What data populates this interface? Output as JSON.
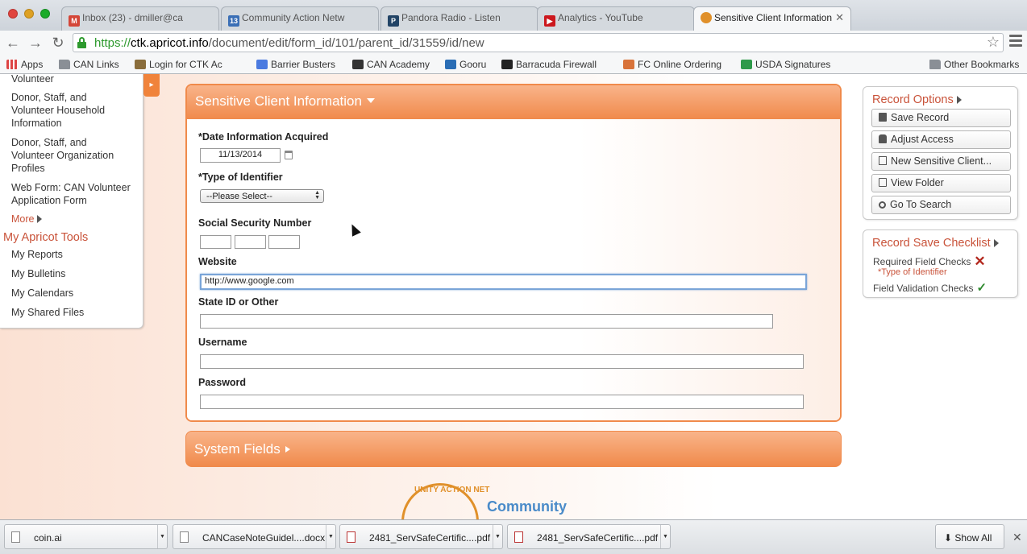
{
  "browser": {
    "tabs": [
      {
        "title": "Inbox (23) - dmiller@ca",
        "icon": "gmail-icon",
        "icon_color": "#d44638"
      },
      {
        "title": "Community Action Netw",
        "icon": "calendar-icon",
        "icon_color": "#3b6fb6"
      },
      {
        "title": "Pandora Radio - Listen",
        "icon": "pandora-icon",
        "icon_color": "#224466"
      },
      {
        "title": "Analytics - YouTube",
        "icon": "youtube-icon",
        "icon_color": "#cc181e"
      },
      {
        "title": "Sensitive Client Information",
        "icon": "apricot-icon",
        "icon_color": "#e0902a"
      }
    ],
    "url": {
      "scheme": "https://",
      "host": "ctk.apricot.info",
      "path": "/document/edit/form_id/101/parent_id/31559/id/new"
    },
    "bookmarks": [
      {
        "label": "Apps",
        "icon": "apps-icon"
      },
      {
        "label": "CAN Links",
        "icon": "folder-icon"
      },
      {
        "label": "Login for CTK Ac",
        "icon": "bookmark-icon"
      },
      {
        "label": "Barrier Busters",
        "icon": "google-icon"
      },
      {
        "label": "CAN Academy",
        "icon": "bookmark-icon"
      },
      {
        "label": "Gooru",
        "icon": "bookmark-icon"
      },
      {
        "label": "Barracuda Firewall",
        "icon": "bookmark-icon"
      },
      {
        "label": "FC Online Ordering",
        "icon": "bookmark-icon"
      },
      {
        "label": "USDA Signatures",
        "icon": "sheets-icon"
      },
      {
        "label": "Other Bookmarks",
        "icon": "folder-icon"
      }
    ]
  },
  "sidebar": {
    "items": [
      {
        "label": "Volunteer"
      },
      {
        "label": "Donor, Staff, and Volunteer Household Information"
      },
      {
        "label": "Donor, Staff, and Volunteer Organization Profiles"
      },
      {
        "label": "Web Form: CAN Volunteer Application Form"
      }
    ],
    "more_label": "More",
    "tools_title": "My Apricot Tools",
    "tools": [
      {
        "label": "My Reports"
      },
      {
        "label": "My Bulletins"
      },
      {
        "label": "My Calendars"
      },
      {
        "label": "My Shared Files"
      }
    ]
  },
  "form": {
    "section_title": "Sensitive Client Information",
    "date_label": "*Date Information Acquired",
    "date_value": "11/13/2014",
    "identifier_label": "*Type of Identifier",
    "identifier_value": "--Please Select--",
    "ssn_label": "Social Security Number",
    "website_label": "Website",
    "website_value": "http://www.google.com",
    "state_id_label": "State ID or Other",
    "username_label": "Username",
    "password_label": "Password",
    "system_fields_title": "System Fields"
  },
  "logo": {
    "ring_text": "UNITY ACTION NET",
    "name": "Community"
  },
  "record_options": {
    "title": "Record Options",
    "buttons": [
      {
        "label": "Save Record",
        "icon": "save-icon"
      },
      {
        "label": "Adjust Access",
        "icon": "lock-icon"
      },
      {
        "label": "New Sensitive Client...",
        "icon": "new-record-icon"
      },
      {
        "label": "View Folder",
        "icon": "folder-icon"
      },
      {
        "label": "Go To Search",
        "icon": "search-icon"
      }
    ]
  },
  "checklist": {
    "title": "Record Save Checklist",
    "required_label": "Required Field Checks",
    "required_missing": "*Type of Identifier",
    "validation_label": "Field Validation Checks"
  },
  "downloads": {
    "items": [
      {
        "name": "coin.ai",
        "type": "ai"
      },
      {
        "name": "CANCaseNoteGuidel....docx",
        "type": "docx"
      },
      {
        "name": "2481_ServSafeCertific....pdf",
        "type": "pdf"
      },
      {
        "name": "2481_ServSafeCertific....pdf",
        "type": "pdf"
      }
    ],
    "show_all_label": "Show All"
  },
  "colors": {
    "accent": "#f08a4b",
    "link": "#c9533a",
    "secure": "#2e9a2e"
  }
}
